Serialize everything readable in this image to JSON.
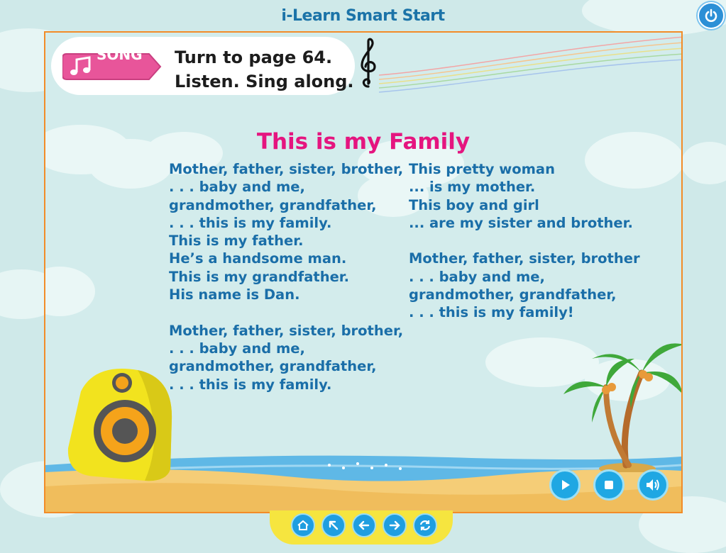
{
  "app": {
    "title": "i-Learn Smart Start"
  },
  "header": {
    "power_icon": "power-icon"
  },
  "banner": {
    "tag_label": "SONG",
    "tag_icon": "music-note-icon",
    "instruction_line1": "Turn to page 64.",
    "instruction_line2": "Listen. Sing along."
  },
  "song": {
    "title": "This is my Family",
    "left_lines": [
      "Mother, father, sister, brother,",
      ". . . baby and me,",
      "grandmother, grandfather,",
      ". . . this is my family.",
      "This is my father.",
      "He’s a handsome man.",
      "This is my grandfather.",
      "His name is Dan.",
      "",
      "Mother, father, sister, brother,",
      ". . . baby and me,",
      "grandmother, grandfather,",
      ". . . this is my family."
    ],
    "right_lines": [
      "This pretty woman",
      "... is my mother.",
      "This boy and girl",
      "... are my sister and brother.",
      "",
      "Mother, father, sister, brother",
      ". . . baby and me,",
      "grandmother, grandfather,",
      ". . . this is my family!"
    ]
  },
  "controls": [
    "play-icon",
    "stop-icon",
    "volume-icon"
  ],
  "nav": [
    "home-icon",
    "expand-icon",
    "back-arrow-icon",
    "forward-arrow-icon",
    "refresh-icon"
  ],
  "colors": {
    "title_pink": "#e5157f",
    "lyrics_blue": "#1a6ea8",
    "frame_orange": "#f28c28",
    "button_blue": "#1fa7e3",
    "nav_yellow": "#f6e53f"
  }
}
